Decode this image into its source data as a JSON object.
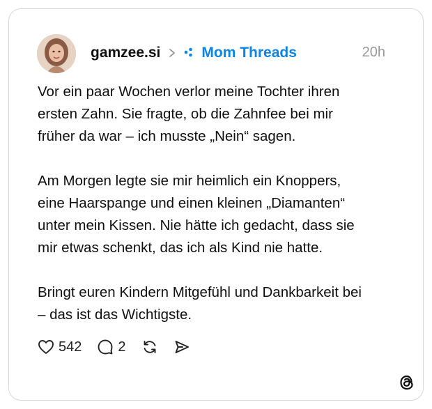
{
  "post": {
    "username": "gamzee.si",
    "community": "Mom Threads",
    "time": "20h",
    "paragraphs": [
      "Vor ein paar Wochen verlor meine Tochter ihren\nersten Zahn. Sie fragte, ob die Zahnfee bei mir\nfrüher da war – ich musste „Nein“ sagen.",
      "Am Morgen legte sie mir heimlich ein Knoppers,\neine Haarspange und einen kleinen „Diamanten“\nunter mein Kissen. Nie hätte ich gedacht, dass sie\nmir etwas schenkt, das ich als Kind nie hatte.",
      "Bringt euren Kindern Mitgefühl und Dankbarkeit bei\n– das ist das Wichtigste."
    ]
  },
  "actions": {
    "likes": "542",
    "comments": "2"
  },
  "icons": [
    "heart-icon",
    "comment-icon",
    "repost-icon",
    "share-icon",
    "chevron-right-icon",
    "community-icon",
    "threads-logo-icon"
  ],
  "colors": {
    "community": "#0a84e6",
    "time": "#9a9a9a",
    "border": "#d8d8d8"
  }
}
